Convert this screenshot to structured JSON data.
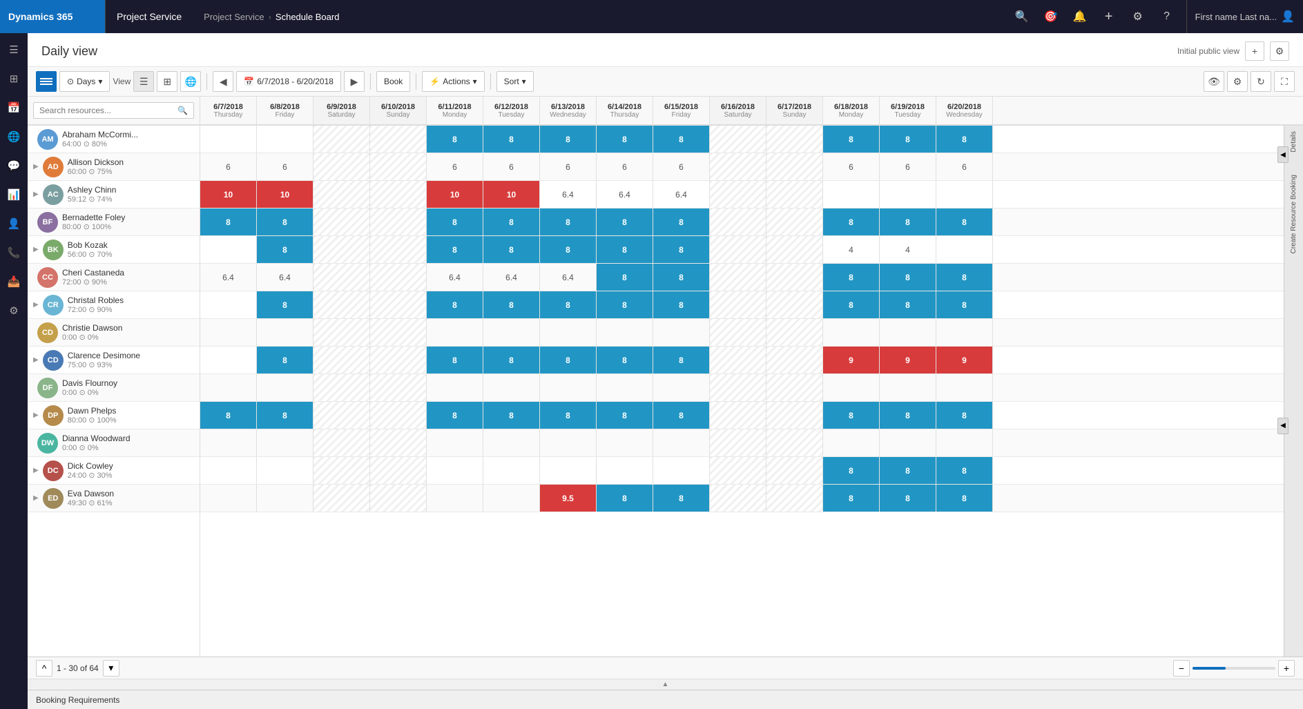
{
  "topNav": {
    "brand": "Dynamics 365",
    "appName": "Project Service",
    "breadcrumb": [
      "Project Service",
      "Schedule Board"
    ],
    "userLabel": "First name Last na...",
    "icons": [
      "search",
      "target",
      "bell",
      "plus",
      "settings",
      "help"
    ]
  },
  "page": {
    "title": "Daily view",
    "viewLabel": "Initial public view",
    "addBtn": "+",
    "settingsBtn": "⚙"
  },
  "toolbar": {
    "daysLabel": "Days",
    "viewLabel": "View",
    "dateRange": "6/7/2018 - 6/20/2018",
    "bookLabel": "Book",
    "actionsLabel": "Actions",
    "sortLabel": "Sort"
  },
  "search": {
    "placeholder": "Search resources..."
  },
  "dateHeaders": [
    {
      "date": "6/7/2018",
      "day": "Thursday",
      "weekend": false
    },
    {
      "date": "6/8/2018",
      "day": "Friday",
      "weekend": false
    },
    {
      "date": "6/9/2018",
      "day": "Saturday",
      "weekend": true
    },
    {
      "date": "6/10/2018",
      "day": "Sunday",
      "weekend": true
    },
    {
      "date": "6/11/2018",
      "day": "Monday",
      "weekend": false
    },
    {
      "date": "6/12/2018",
      "day": "Tuesday",
      "weekend": false
    },
    {
      "date": "6/13/2018",
      "day": "Wednesday",
      "weekend": false
    },
    {
      "date": "6/14/2018",
      "day": "Thursday",
      "weekend": false
    },
    {
      "date": "6/15/2018",
      "day": "Friday",
      "weekend": false
    },
    {
      "date": "6/16/2018",
      "day": "Saturday",
      "weekend": true
    },
    {
      "date": "6/17/2018",
      "day": "Sunday",
      "weekend": true
    },
    {
      "date": "6/18/2018",
      "day": "Monday",
      "weekend": false
    },
    {
      "date": "6/19/2018",
      "day": "Tuesday",
      "weekend": false
    },
    {
      "date": "6/20/2018",
      "day": "Wednesday",
      "weekend": false
    }
  ],
  "resources": [
    {
      "name": "Abraham McCormi...",
      "meta": "64:00 ⊙  80%",
      "cells": [
        "",
        "",
        "",
        "",
        "8",
        "8",
        "8",
        "8",
        "8",
        "",
        "",
        "8",
        "8",
        "8"
      ],
      "cellTypes": [
        "",
        "",
        "",
        "",
        "blue",
        "blue",
        "blue",
        "blue",
        "blue",
        "",
        "",
        "blue",
        "blue",
        "blue"
      ]
    },
    {
      "name": "Allison Dickson",
      "meta": "60:00 ⊙  75%",
      "cells": [
        "6",
        "6",
        "",
        "",
        "6",
        "6",
        "6",
        "6",
        "6",
        "",
        "",
        "6",
        "6",
        "6"
      ],
      "cellTypes": [
        "num",
        "num",
        "",
        "",
        "num",
        "num",
        "num",
        "num",
        "num",
        "",
        "",
        "num",
        "num",
        "num"
      ]
    },
    {
      "name": "Ashley Chinn",
      "meta": "59:12 ⊙  74%",
      "cells": [
        "10",
        "10",
        "",
        "",
        "10",
        "10",
        "6.4",
        "6.4",
        "6.4",
        "",
        "",
        "",
        "",
        ""
      ],
      "cellTypes": [
        "red",
        "red",
        "",
        "",
        "red",
        "red",
        "num",
        "num",
        "num",
        "",
        "",
        "",
        "",
        ""
      ]
    },
    {
      "name": "Bernadette Foley",
      "meta": "80:00 ⊙  100%",
      "cells": [
        "8",
        "8",
        "",
        "",
        "8",
        "8",
        "8",
        "8",
        "8",
        "",
        "",
        "8",
        "8",
        "8"
      ],
      "cellTypes": [
        "blue",
        "blue",
        "",
        "",
        "blue",
        "blue",
        "blue",
        "blue",
        "blue",
        "",
        "",
        "blue",
        "blue",
        "blue"
      ]
    },
    {
      "name": "Bob Kozak",
      "meta": "56:00 ⊙  70%",
      "cells": [
        "",
        "8",
        "",
        "",
        "8",
        "8",
        "8",
        "8",
        "8",
        "",
        "",
        "4",
        "4",
        ""
      ],
      "cellTypes": [
        "",
        "blue",
        "",
        "",
        "blue",
        "blue",
        "blue",
        "blue",
        "blue",
        "",
        "",
        "num",
        "num",
        ""
      ]
    },
    {
      "name": "Cheri Castaneda",
      "meta": "72:00 ⊙  90%",
      "cells": [
        "6.4",
        "6.4",
        "",
        "",
        "6.4",
        "6.4",
        "6.4",
        "8",
        "8",
        "",
        "",
        "8",
        "8",
        "8"
      ],
      "cellTypes": [
        "num",
        "num",
        "",
        "",
        "num",
        "num",
        "num",
        "blue",
        "blue",
        "",
        "",
        "blue",
        "blue",
        "blue"
      ]
    },
    {
      "name": "Christal Robles",
      "meta": "72:00 ⊙  90%",
      "cells": [
        "",
        "8",
        "",
        "",
        "8",
        "8",
        "8",
        "8",
        "8",
        "",
        "",
        "8",
        "8",
        "8"
      ],
      "cellTypes": [
        "",
        "blue",
        "",
        "",
        "blue",
        "blue",
        "blue",
        "blue",
        "blue",
        "",
        "",
        "blue",
        "blue",
        "blue"
      ]
    },
    {
      "name": "Christie Dawson",
      "meta": "0:00 ⊙  0%",
      "cells": [
        "",
        "",
        "",
        "",
        "",
        "",
        "",
        "",
        "",
        "",
        "",
        "",
        "",
        ""
      ],
      "cellTypes": [
        "",
        "",
        "",
        "",
        "",
        "",
        "",
        "",
        "",
        "",
        "",
        "",
        "",
        ""
      ]
    },
    {
      "name": "Clarence Desimone",
      "meta": "75:00 ⊙  93%",
      "cells": [
        "",
        "8",
        "",
        "",
        "8",
        "8",
        "8",
        "8",
        "8",
        "",
        "",
        "9",
        "9",
        "9"
      ],
      "cellTypes": [
        "",
        "blue",
        "",
        "",
        "blue",
        "blue",
        "blue",
        "blue",
        "blue",
        "",
        "",
        "red",
        "red",
        "red"
      ]
    },
    {
      "name": "Davis Flournoy",
      "meta": "0:00 ⊙  0%",
      "cells": [
        "",
        "",
        "",
        "",
        "",
        "",
        "",
        "",
        "",
        "",
        "",
        "",
        "",
        ""
      ],
      "cellTypes": [
        "",
        "",
        "",
        "",
        "",
        "",
        "",
        "",
        "",
        "",
        "",
        "",
        "",
        ""
      ]
    },
    {
      "name": "Dawn Phelps",
      "meta": "80:00 ⊙  100%",
      "cells": [
        "8",
        "8",
        "",
        "",
        "8",
        "8",
        "8",
        "8",
        "8",
        "",
        "",
        "8",
        "8",
        "8"
      ],
      "cellTypes": [
        "blue",
        "blue",
        "",
        "",
        "blue",
        "blue",
        "blue",
        "blue",
        "blue",
        "",
        "",
        "blue",
        "blue",
        "blue"
      ]
    },
    {
      "name": "Dianna Woodward",
      "meta": "0:00 ⊙  0%",
      "cells": [
        "",
        "",
        "",
        "",
        "",
        "",
        "",
        "",
        "",
        "",
        "",
        "",
        "",
        ""
      ],
      "cellTypes": [
        "",
        "",
        "",
        "",
        "",
        "",
        "",
        "",
        "",
        "",
        "",
        "",
        "",
        ""
      ]
    },
    {
      "name": "Dick Cowley",
      "meta": "24:00 ⊙  30%",
      "cells": [
        "",
        "",
        "",
        "",
        "",
        "",
        "",
        "",
        "",
        "",
        "",
        "8",
        "8",
        "8"
      ],
      "cellTypes": [
        "",
        "",
        "",
        "",
        "",
        "",
        "",
        "",
        "",
        "",
        "",
        "blue",
        "blue",
        "blue"
      ]
    },
    {
      "name": "Eva Dawson",
      "meta": "49:30 ⊙  61%",
      "cells": [
        "",
        "",
        "",
        "",
        "",
        "",
        "9.5",
        "8",
        "8",
        "",
        "",
        "8",
        "8",
        "8"
      ],
      "cellTypes": [
        "",
        "",
        "",
        "",
        "",
        "",
        "red",
        "blue",
        "blue",
        "",
        "",
        "blue",
        "blue",
        "blue"
      ]
    }
  ],
  "pagination": {
    "label": "1 - 30 of 64"
  },
  "bottomBar": {
    "label": "Booking Requirements"
  },
  "rightPanelLabels": {
    "details": "Details",
    "createBooking": "Create Resource Booking"
  }
}
